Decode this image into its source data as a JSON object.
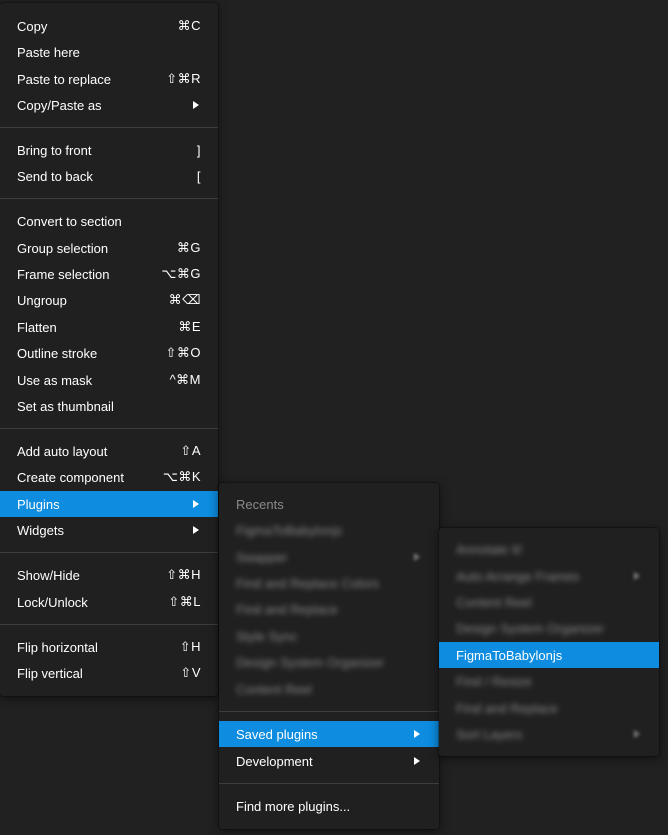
{
  "main_menu": {
    "copy": {
      "label": "Copy",
      "shortcut": "⌘C"
    },
    "paste_here": {
      "label": "Paste here"
    },
    "paste_to_replace": {
      "label": "Paste to replace",
      "shortcut": "⇧⌘R"
    },
    "copy_paste_as": {
      "label": "Copy/Paste as"
    },
    "bring_to_front": {
      "label": "Bring to front",
      "shortcut": "]"
    },
    "send_to_back": {
      "label": "Send to back",
      "shortcut": "["
    },
    "convert_to_section": {
      "label": "Convert to section"
    },
    "group_selection": {
      "label": "Group selection",
      "shortcut": "⌘G"
    },
    "frame_selection": {
      "label": "Frame selection",
      "shortcut": "⌥⌘G"
    },
    "ungroup": {
      "label": "Ungroup",
      "shortcut": "⌘⌫"
    },
    "flatten": {
      "label": "Flatten",
      "shortcut": "⌘E"
    },
    "outline_stroke": {
      "label": "Outline stroke",
      "shortcut": "⇧⌘O"
    },
    "use_as_mask": {
      "label": "Use as mask",
      "shortcut": "^⌘M"
    },
    "set_as_thumbnail": {
      "label": "Set as thumbnail"
    },
    "add_auto_layout": {
      "label": "Add auto layout",
      "shortcut": "⇧A"
    },
    "create_component": {
      "label": "Create component",
      "shortcut": "⌥⌘K"
    },
    "plugins": {
      "label": "Plugins"
    },
    "widgets": {
      "label": "Widgets"
    },
    "show_hide": {
      "label": "Show/Hide",
      "shortcut": "⇧⌘H"
    },
    "lock_unlock": {
      "label": "Lock/Unlock",
      "shortcut": "⇧⌘L"
    },
    "flip_horizontal": {
      "label": "Flip horizontal",
      "shortcut": "⇧H"
    },
    "flip_vertical": {
      "label": "Flip vertical",
      "shortcut": "⇧V"
    }
  },
  "plugins_menu": {
    "recents_header": "Recents",
    "recents": [
      "FigmaToBabylonjs",
      "Swapper",
      "Find and Replace Colors",
      "Find and Replace",
      "Style Sync",
      "Design System Organizer",
      "Content Reel"
    ],
    "saved_plugins": "Saved plugins",
    "development": "Development",
    "find_more": "Find more plugins..."
  },
  "saved_menu": {
    "items": [
      "Annotate It!",
      "Auto Arrange Frames",
      "Content Reel",
      "Design System Organizer",
      "FigmaToBabylonjs",
      "Find / Resize",
      "Find and Replace",
      "Sort Layers"
    ]
  },
  "colors": {
    "background": "#212121",
    "menu": "#202020",
    "highlight": "#0d8ce0",
    "separator": "#3d3d3d"
  }
}
